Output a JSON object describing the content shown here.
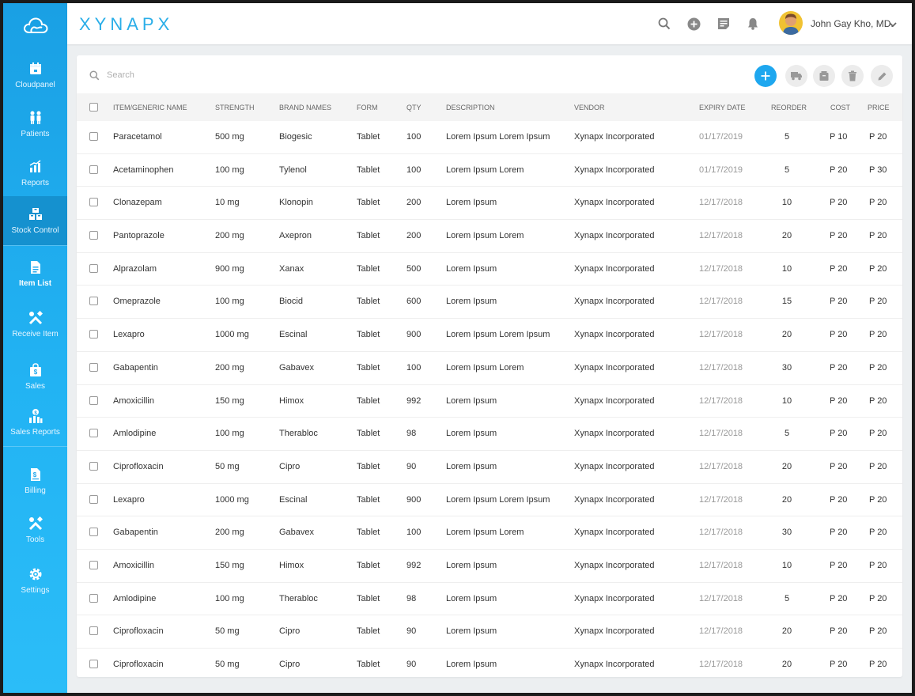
{
  "app": {
    "brand": "XYNAPX",
    "accent": "#1ea7ef"
  },
  "sidebar": {
    "items": [
      {
        "label": "Cloudpanel",
        "icon": "calendar-icon"
      },
      {
        "label": "Patients",
        "icon": "people-icon"
      },
      {
        "label": "Reports",
        "icon": "bar-chart-icon"
      },
      {
        "label": "Stock Control",
        "icon": "boxes-icon"
      },
      {
        "label": "Item List",
        "icon": "document-icon"
      },
      {
        "label": "Receive Item",
        "icon": "tools-icon"
      },
      {
        "label": "Sales",
        "icon": "shopping-bag-icon"
      },
      {
        "label": "Sales Reports",
        "icon": "sales-chart-icon"
      },
      {
        "label": "Billing",
        "icon": "bill-icon"
      },
      {
        "label": "Tools",
        "icon": "wrench-icon"
      },
      {
        "label": "Settings",
        "icon": "gear-icon"
      }
    ]
  },
  "topbar": {
    "user_name": "John Gay Kho, MD."
  },
  "search": {
    "placeholder": "Search"
  },
  "table": {
    "headers": {
      "name": "ITEM/GENERIC NAME",
      "strength": "STRENGTH",
      "brand": "BRAND NAMES",
      "form": "FORM",
      "qty": "QTY",
      "description": "DESCRIPTION",
      "vendor": "VENDOR",
      "expiry": "EXPIRY DATE",
      "reorder": "REORDER",
      "cost": "COST",
      "price": "PRICE"
    },
    "rows": [
      {
        "name": "Paracetamol",
        "strength": "500 mg",
        "brand": "Biogesic",
        "form": "Tablet",
        "qty": "100",
        "description": "Lorem Ipsum Lorem Ipsum",
        "vendor": "Xynapx Incorporated",
        "expiry": "01/17/2019",
        "reorder": "5",
        "cost": "P 10",
        "price": "P 20"
      },
      {
        "name": "Acetaminophen",
        "strength": "100 mg",
        "brand": "Tylenol",
        "form": "Tablet",
        "qty": "100",
        "description": "Lorem Ipsum Lorem",
        "vendor": "Xynapx Incorporated",
        "expiry": "01/17/2019",
        "reorder": "5",
        "cost": "P 20",
        "price": "P 30"
      },
      {
        "name": "Clonazepam",
        "strength": "10 mg",
        "brand": "Klonopin",
        "form": "Tablet",
        "qty": "200",
        "description": "Lorem Ipsum",
        "vendor": "Xynapx Incorporated",
        "expiry": "12/17/2018",
        "reorder": "10",
        "cost": "P 20",
        "price": "P 20"
      },
      {
        "name": "Pantoprazole",
        "strength": "200 mg",
        "brand": "Axepron",
        "form": "Tablet",
        "qty": "200",
        "description": "Lorem Ipsum Lorem",
        "vendor": "Xynapx Incorporated",
        "expiry": "12/17/2018",
        "reorder": "20",
        "cost": "P 20",
        "price": "P 20"
      },
      {
        "name": "Alprazolam",
        "strength": "900 mg",
        "brand": "Xanax",
        "form": "Tablet",
        "qty": "500",
        "description": "Lorem Ipsum",
        "vendor": "Xynapx Incorporated",
        "expiry": "12/17/2018",
        "reorder": "10",
        "cost": "P 20",
        "price": "P 20"
      },
      {
        "name": "Omeprazole",
        "strength": "100 mg",
        "brand": "Biocid",
        "form": "Tablet",
        "qty": "600",
        "description": "Lorem Ipsum",
        "vendor": "Xynapx Incorporated",
        "expiry": "12/17/2018",
        "reorder": "15",
        "cost": "P 20",
        "price": "P 20"
      },
      {
        "name": "Lexapro",
        "strength": "1000 mg",
        "brand": "Escinal",
        "form": "Tablet",
        "qty": "900",
        "description": "Lorem Ipsum Lorem Ipsum",
        "vendor": "Xynapx Incorporated",
        "expiry": "12/17/2018",
        "reorder": "20",
        "cost": "P 20",
        "price": "P 20"
      },
      {
        "name": "Gabapentin",
        "strength": "200 mg",
        "brand": "Gabavex",
        "form": "Tablet",
        "qty": "100",
        "description": "Lorem Ipsum Lorem",
        "vendor": "Xynapx Incorporated",
        "expiry": "12/17/2018",
        "reorder": "30",
        "cost": "P 20",
        "price": "P 20"
      },
      {
        "name": "Amoxicillin",
        "strength": "150 mg",
        "brand": "Himox",
        "form": "Tablet",
        "qty": "992",
        "description": "Lorem Ipsum",
        "vendor": "Xynapx Incorporated",
        "expiry": "12/17/2018",
        "reorder": "10",
        "cost": "P 20",
        "price": "P 20"
      },
      {
        "name": "Amlodipine",
        "strength": "100 mg",
        "brand": "Therabloc",
        "form": "Tablet",
        "qty": "98",
        "description": "Lorem Ipsum",
        "vendor": "Xynapx Incorporated",
        "expiry": "12/17/2018",
        "reorder": "5",
        "cost": "P 20",
        "price": "P 20"
      },
      {
        "name": "Ciprofloxacin",
        "strength": "50 mg",
        "brand": "Cipro",
        "form": "Tablet",
        "qty": "90",
        "description": "Lorem Ipsum",
        "vendor": "Xynapx Incorporated",
        "expiry": "12/17/2018",
        "reorder": "20",
        "cost": "P 20",
        "price": "P 20"
      },
      {
        "name": "Lexapro",
        "strength": "1000 mg",
        "brand": "Escinal",
        "form": "Tablet",
        "qty": "900",
        "description": "Lorem Ipsum Lorem Ipsum",
        "vendor": "Xynapx Incorporated",
        "expiry": "12/17/2018",
        "reorder": "20",
        "cost": "P 20",
        "price": "P 20"
      },
      {
        "name": "Gabapentin",
        "strength": "200 mg",
        "brand": "Gabavex",
        "form": "Tablet",
        "qty": "100",
        "description": "Lorem Ipsum Lorem",
        "vendor": "Xynapx Incorporated",
        "expiry": "12/17/2018",
        "reorder": "30",
        "cost": "P 20",
        "price": "P 20"
      },
      {
        "name": "Amoxicillin",
        "strength": "150 mg",
        "brand": "Himox",
        "form": "Tablet",
        "qty": "992",
        "description": "Lorem Ipsum",
        "vendor": "Xynapx Incorporated",
        "expiry": "12/17/2018",
        "reorder": "10",
        "cost": "P 20",
        "price": "P 20"
      },
      {
        "name": "Amlodipine",
        "strength": "100 mg",
        "brand": "Therabloc",
        "form": "Tablet",
        "qty": "98",
        "description": "Lorem Ipsum",
        "vendor": "Xynapx Incorporated",
        "expiry": "12/17/2018",
        "reorder": "5",
        "cost": "P 20",
        "price": "P 20"
      },
      {
        "name": "Ciprofloxacin",
        "strength": "50 mg",
        "brand": "Cipro",
        "form": "Tablet",
        "qty": "90",
        "description": "Lorem Ipsum",
        "vendor": "Xynapx Incorporated",
        "expiry": "12/17/2018",
        "reorder": "20",
        "cost": "P 20",
        "price": "P 20"
      },
      {
        "name": "Ciprofloxacin",
        "strength": "50 mg",
        "brand": "Cipro",
        "form": "Tablet",
        "qty": "90",
        "description": "Lorem Ipsum",
        "vendor": "Xynapx Incorporated",
        "expiry": "12/17/2018",
        "reorder": "20",
        "cost": "P 20",
        "price": "P 20"
      }
    ]
  }
}
